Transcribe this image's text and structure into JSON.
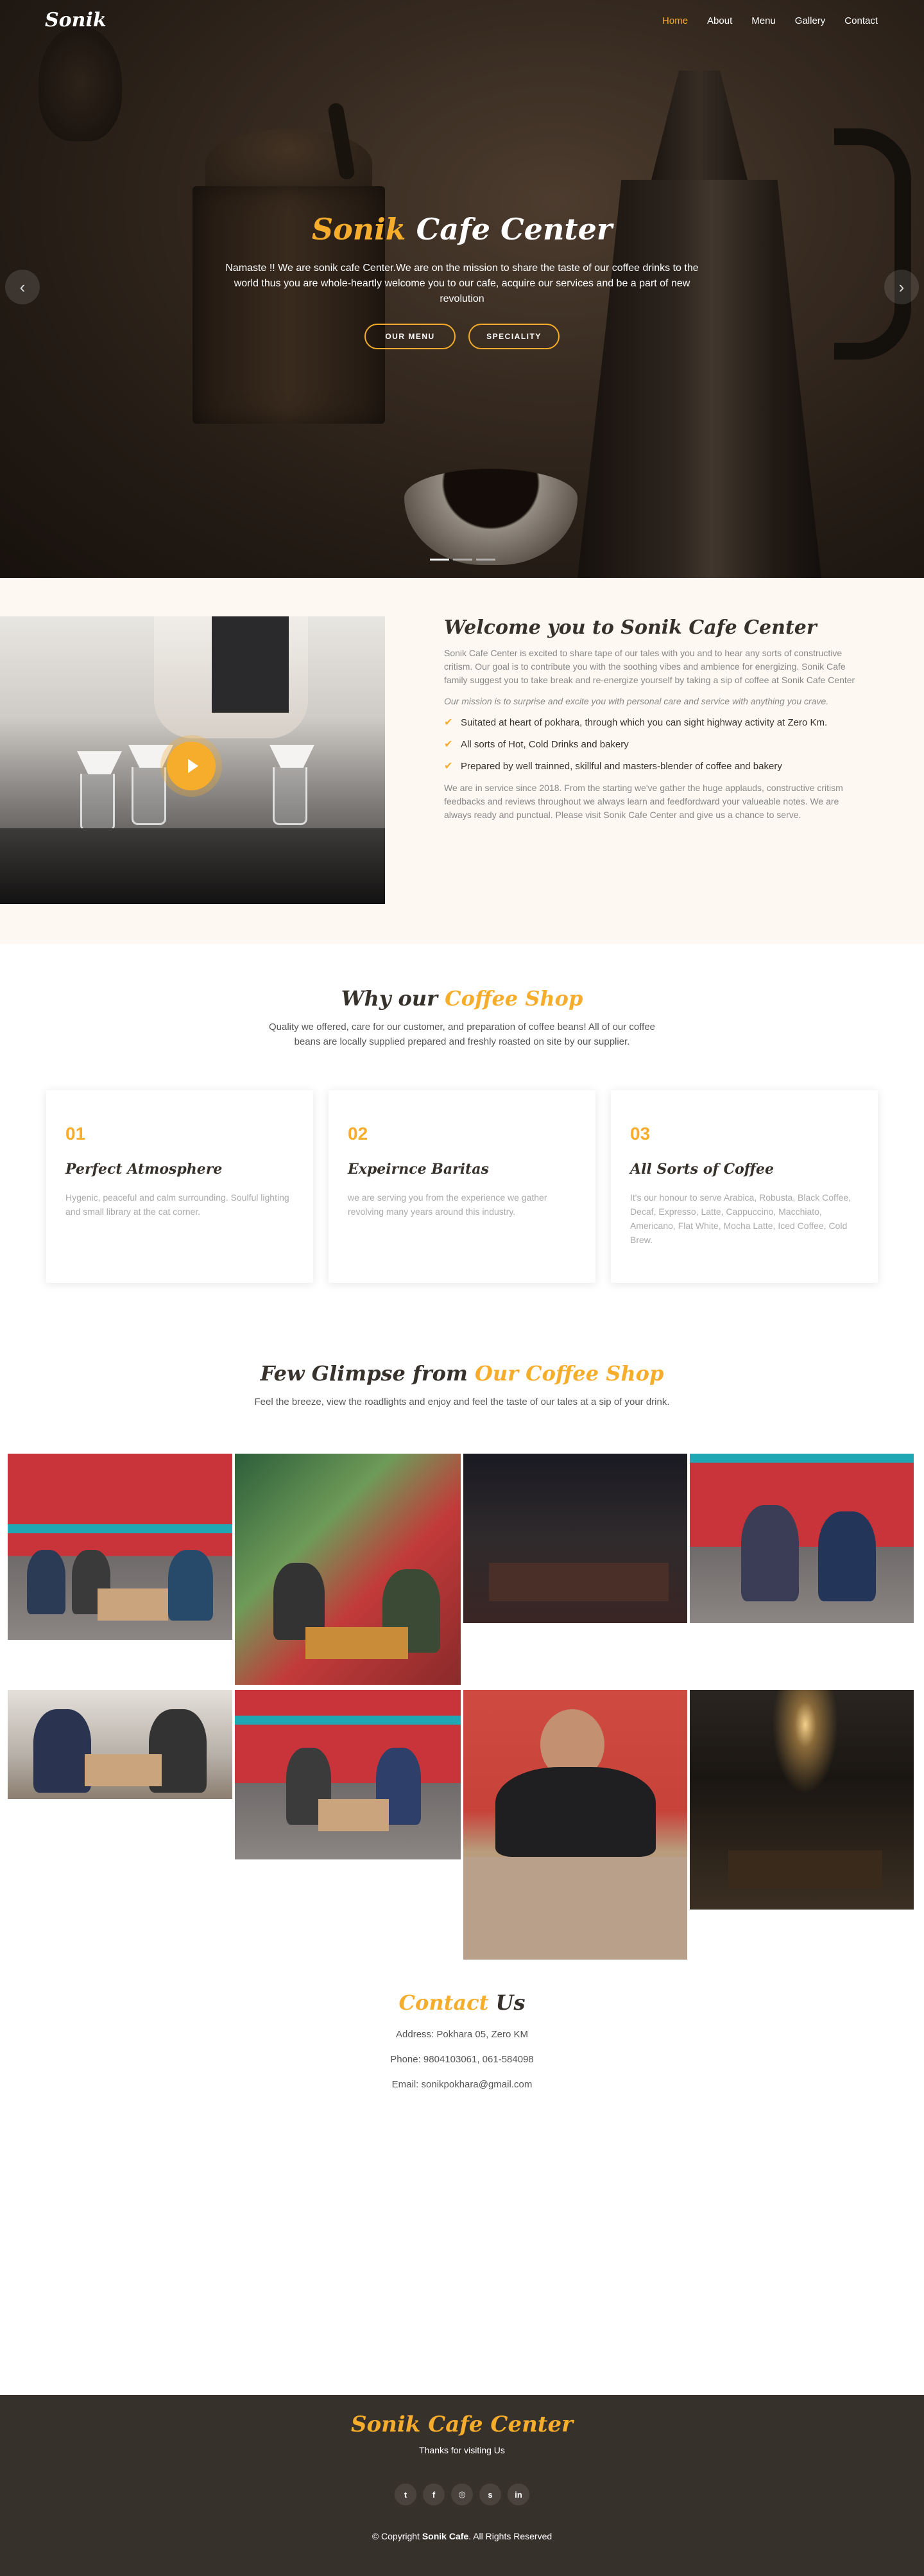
{
  "nav": {
    "logo": "Sonik",
    "links": [
      {
        "label": "Home",
        "active": true
      },
      {
        "label": "About",
        "active": false
      },
      {
        "label": "Menu",
        "active": false
      },
      {
        "label": "Gallery",
        "active": false
      },
      {
        "label": "Contact",
        "active": false
      }
    ]
  },
  "hero": {
    "title_accent": "Sonik",
    "title_rest": "Cafe Center",
    "text": "Namaste !! We are sonik cafe Center.We are on the mission to share the taste of our coffee drinks to the world thus you are whole-heartly welcome you to our cafe, acquire our services and be a part of new revolution",
    "btn_menu": "OUR MENU",
    "btn_speciality": "SPECIALITY",
    "prev_icon": "chevron-left-icon",
    "next_icon": "chevron-right-icon"
  },
  "about": {
    "title_plain": "Welcome you to",
    "title_bold": "Sonik Cafe Center",
    "p1": "Sonik Cafe Center is excited to share tape of our tales with you and to hear any sorts of constructive critism. Our goal is to contribute you with the soothing vibes and ambience for energizing. Sonik Cafe family suggest you to take break and re-energize yourself by taking a sip of coffee at Sonik Cafe Center",
    "p2": "Our mission is to surprise and excite you with personal care and service with anything you crave.",
    "list": [
      "Suitated at heart of pokhara, through which you can sight highway activity at Zero Km.",
      "All sorts of Hot, Cold Drinks and bakery",
      "Prepared by well trainned, skillful and masters-blender of coffee and bakery"
    ],
    "p3": "We are in service since 2018. From the starting we've gather the huge applauds, constructive critism feedbacks and reviews throughout we always learn and feedfordward your valueable notes. We are always ready and punctual. Please visit Sonik Cafe Center and give us a chance to serve."
  },
  "why": {
    "title_plain": "Why our",
    "title_accent": "Coffee Shop",
    "subtitle": "Quality we offered, care for our customer, and preparation of coffee beans! All of our coffee beans are locally supplied prepared and freshly roasted on site by our supplier.",
    "cards": [
      {
        "num": "01",
        "title": "Perfect Atmosphere",
        "text": "Hygenic, peaceful and calm surrounding. Soulful lighting and small library at the cat corner."
      },
      {
        "num": "02",
        "title": "Expeirnce Baritas",
        "text": "we are serving you from the experience we gather revolving many years around this industry."
      },
      {
        "num": "03",
        "title": "All Sorts of Coffee",
        "text": "It's our honour to serve Arabica, Robusta, Black Coffee, Decaf, Expresso, Latte, Cappuccino, Macchiato, Americano, Flat White, Mocha Latte, Iced Coffee, Cold Brew."
      }
    ]
  },
  "gallery": {
    "title_plain": "Few Glimpse from",
    "title_accent": "Our Coffee Shop",
    "subtitle": "Feel the breeze, view the roadlights and enjoy and feel the taste of our tales at a sip of your drink."
  },
  "contact": {
    "title_accent": "Contact",
    "title_plain": "Us",
    "address": "Address: Pokhara 05, Zero KM",
    "phone": "Phone: 9804103061, 061-584098",
    "email": "Email: sonikpokhara@gmail.com"
  },
  "footer": {
    "title": "Sonik Cafe Center",
    "sub": "Thanks for visiting Us",
    "social": [
      {
        "icon": "twitter-icon",
        "glyph": "t"
      },
      {
        "icon": "facebook-icon",
        "glyph": "f"
      },
      {
        "icon": "instagram-icon",
        "glyph": "◎"
      },
      {
        "icon": "skype-icon",
        "glyph": "s"
      },
      {
        "icon": "linkedin-icon",
        "glyph": "in"
      }
    ],
    "copy_prefix": "© Copyright",
    "copy_brand": "Sonik Cafe",
    "copy_suffix": ". All Rights Reserved"
  },
  "colors": {
    "accent": "#f6ad2b",
    "dark": "#37312c",
    "about_bg": "#fdf8f1"
  }
}
